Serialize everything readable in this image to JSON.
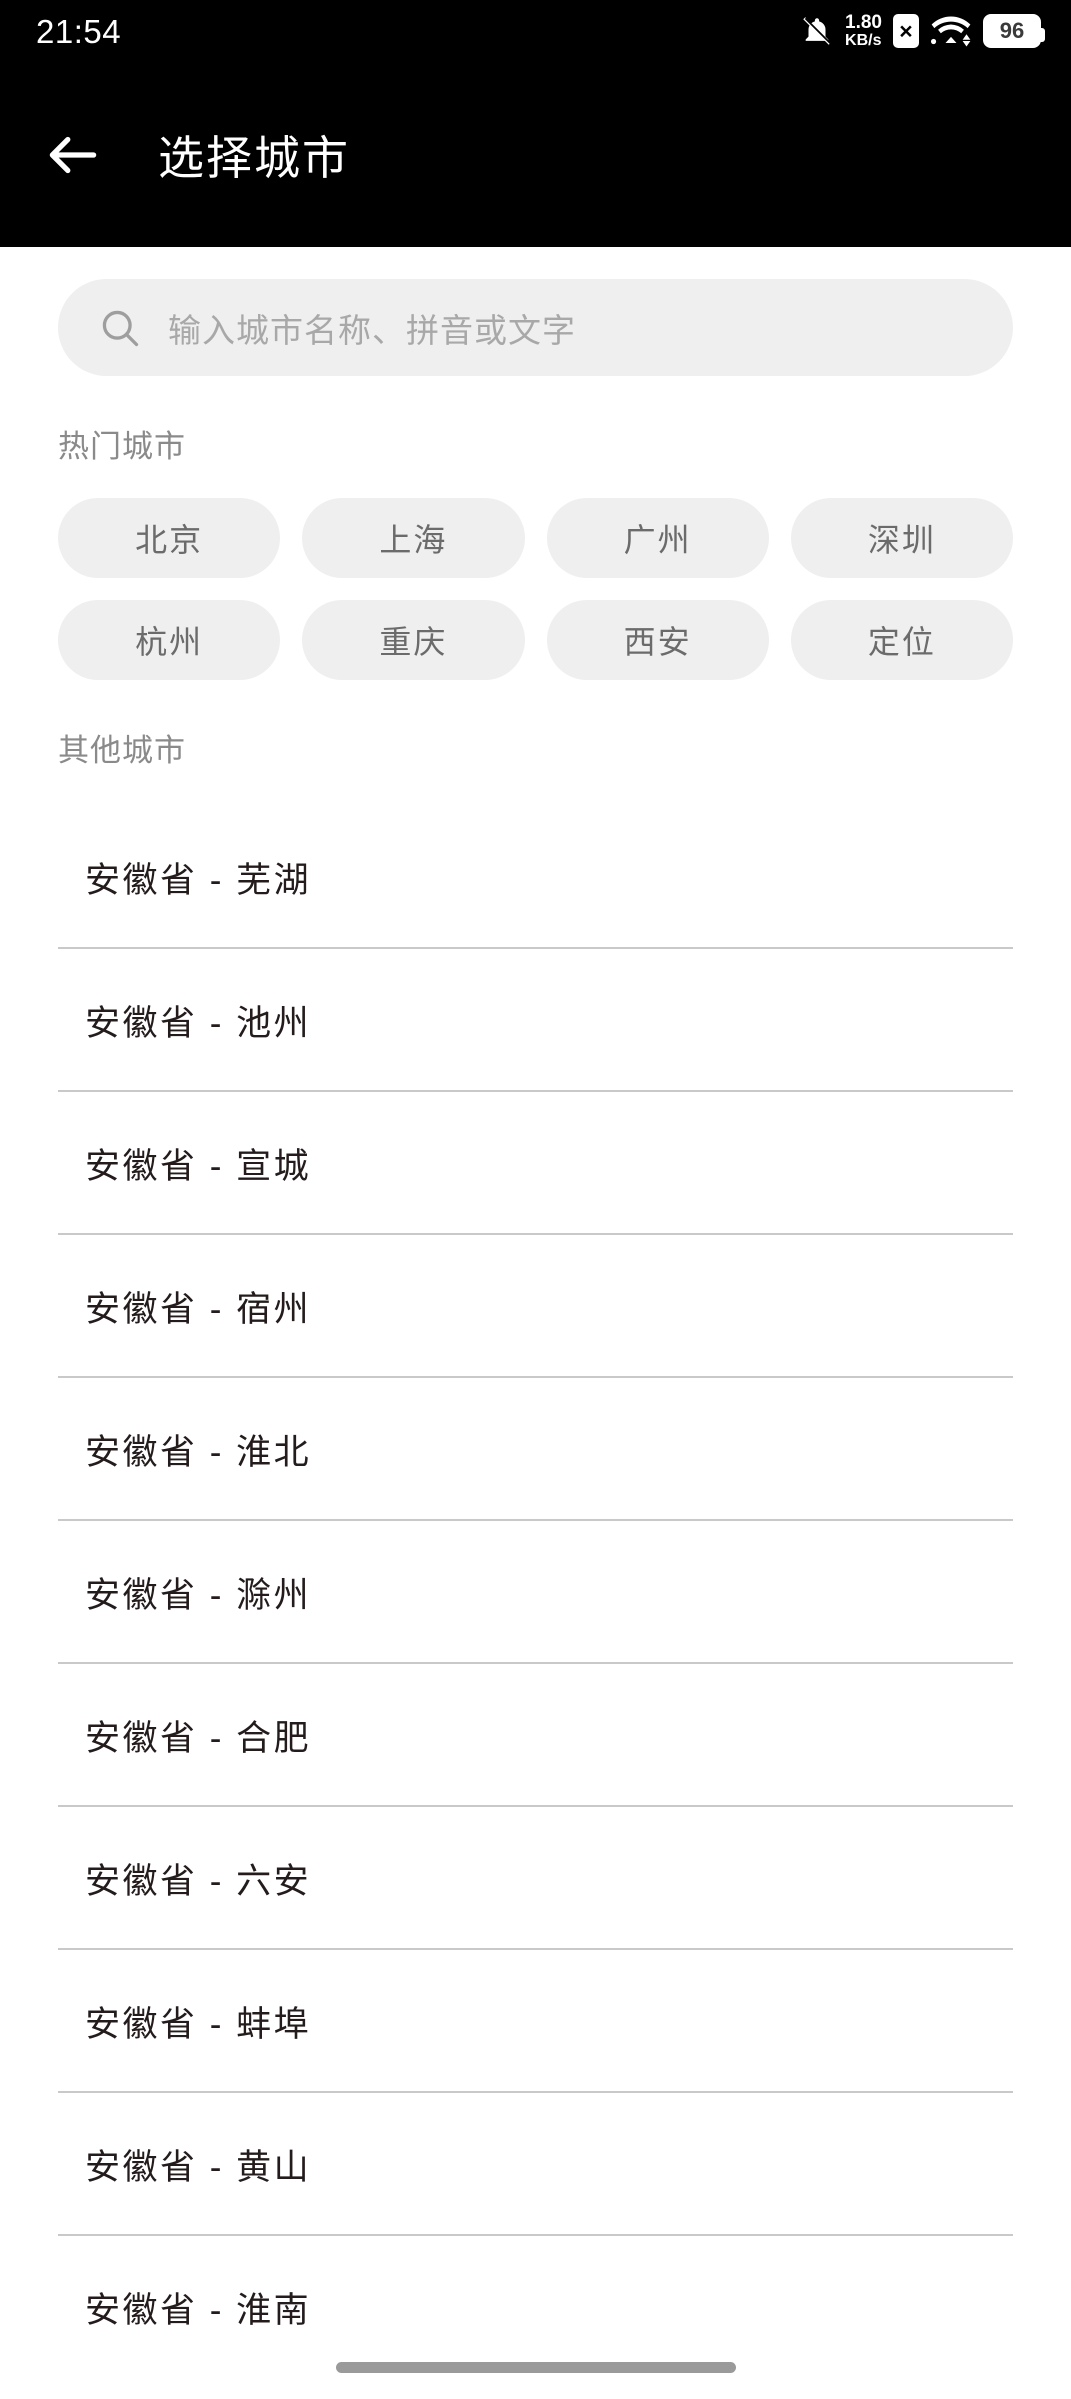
{
  "status_bar": {
    "time": "21:54",
    "network_speed_value": "1.80",
    "network_speed_unit": "KB/s",
    "battery_level": "96",
    "icons": [
      "bell-muted-icon",
      "sim-card-error-icon",
      "wifi-icon",
      "battery-icon"
    ]
  },
  "app_bar": {
    "back_icon": "arrow-left-icon",
    "title": "选择城市"
  },
  "search": {
    "icon": "search-icon",
    "placeholder": "输入城市名称、拼音或文字",
    "value": ""
  },
  "hot_cities": {
    "title": "热门城市",
    "items": [
      {
        "label": "北京"
      },
      {
        "label": "上海"
      },
      {
        "label": "广州"
      },
      {
        "label": "深圳"
      },
      {
        "label": "杭州"
      },
      {
        "label": "重庆"
      },
      {
        "label": "西安"
      },
      {
        "label": "定位"
      }
    ]
  },
  "other_cities": {
    "title": "其他城市",
    "items": [
      {
        "label": "安徽省 - 芜湖"
      },
      {
        "label": "安徽省 - 池州"
      },
      {
        "label": "安徽省 - 宣城"
      },
      {
        "label": "安徽省 - 宿州"
      },
      {
        "label": "安徽省 - 淮北"
      },
      {
        "label": "安徽省 - 滁州"
      },
      {
        "label": "安徽省 - 合肥"
      },
      {
        "label": "安徽省 - 六安"
      },
      {
        "label": "安徽省 - 蚌埠"
      },
      {
        "label": "安徽省 - 黄山"
      },
      {
        "label": "安徽省 - 淮南"
      }
    ]
  },
  "colors": {
    "app_bar_bg": "#000000",
    "page_bg": "#ffffff",
    "chip_bg": "#efefef",
    "chip_text": "#6b6b6b",
    "section_title": "#8a8a8a",
    "list_text": "#241c1c",
    "divider": "#c9c9c9",
    "placeholder": "#a8a8a8"
  }
}
